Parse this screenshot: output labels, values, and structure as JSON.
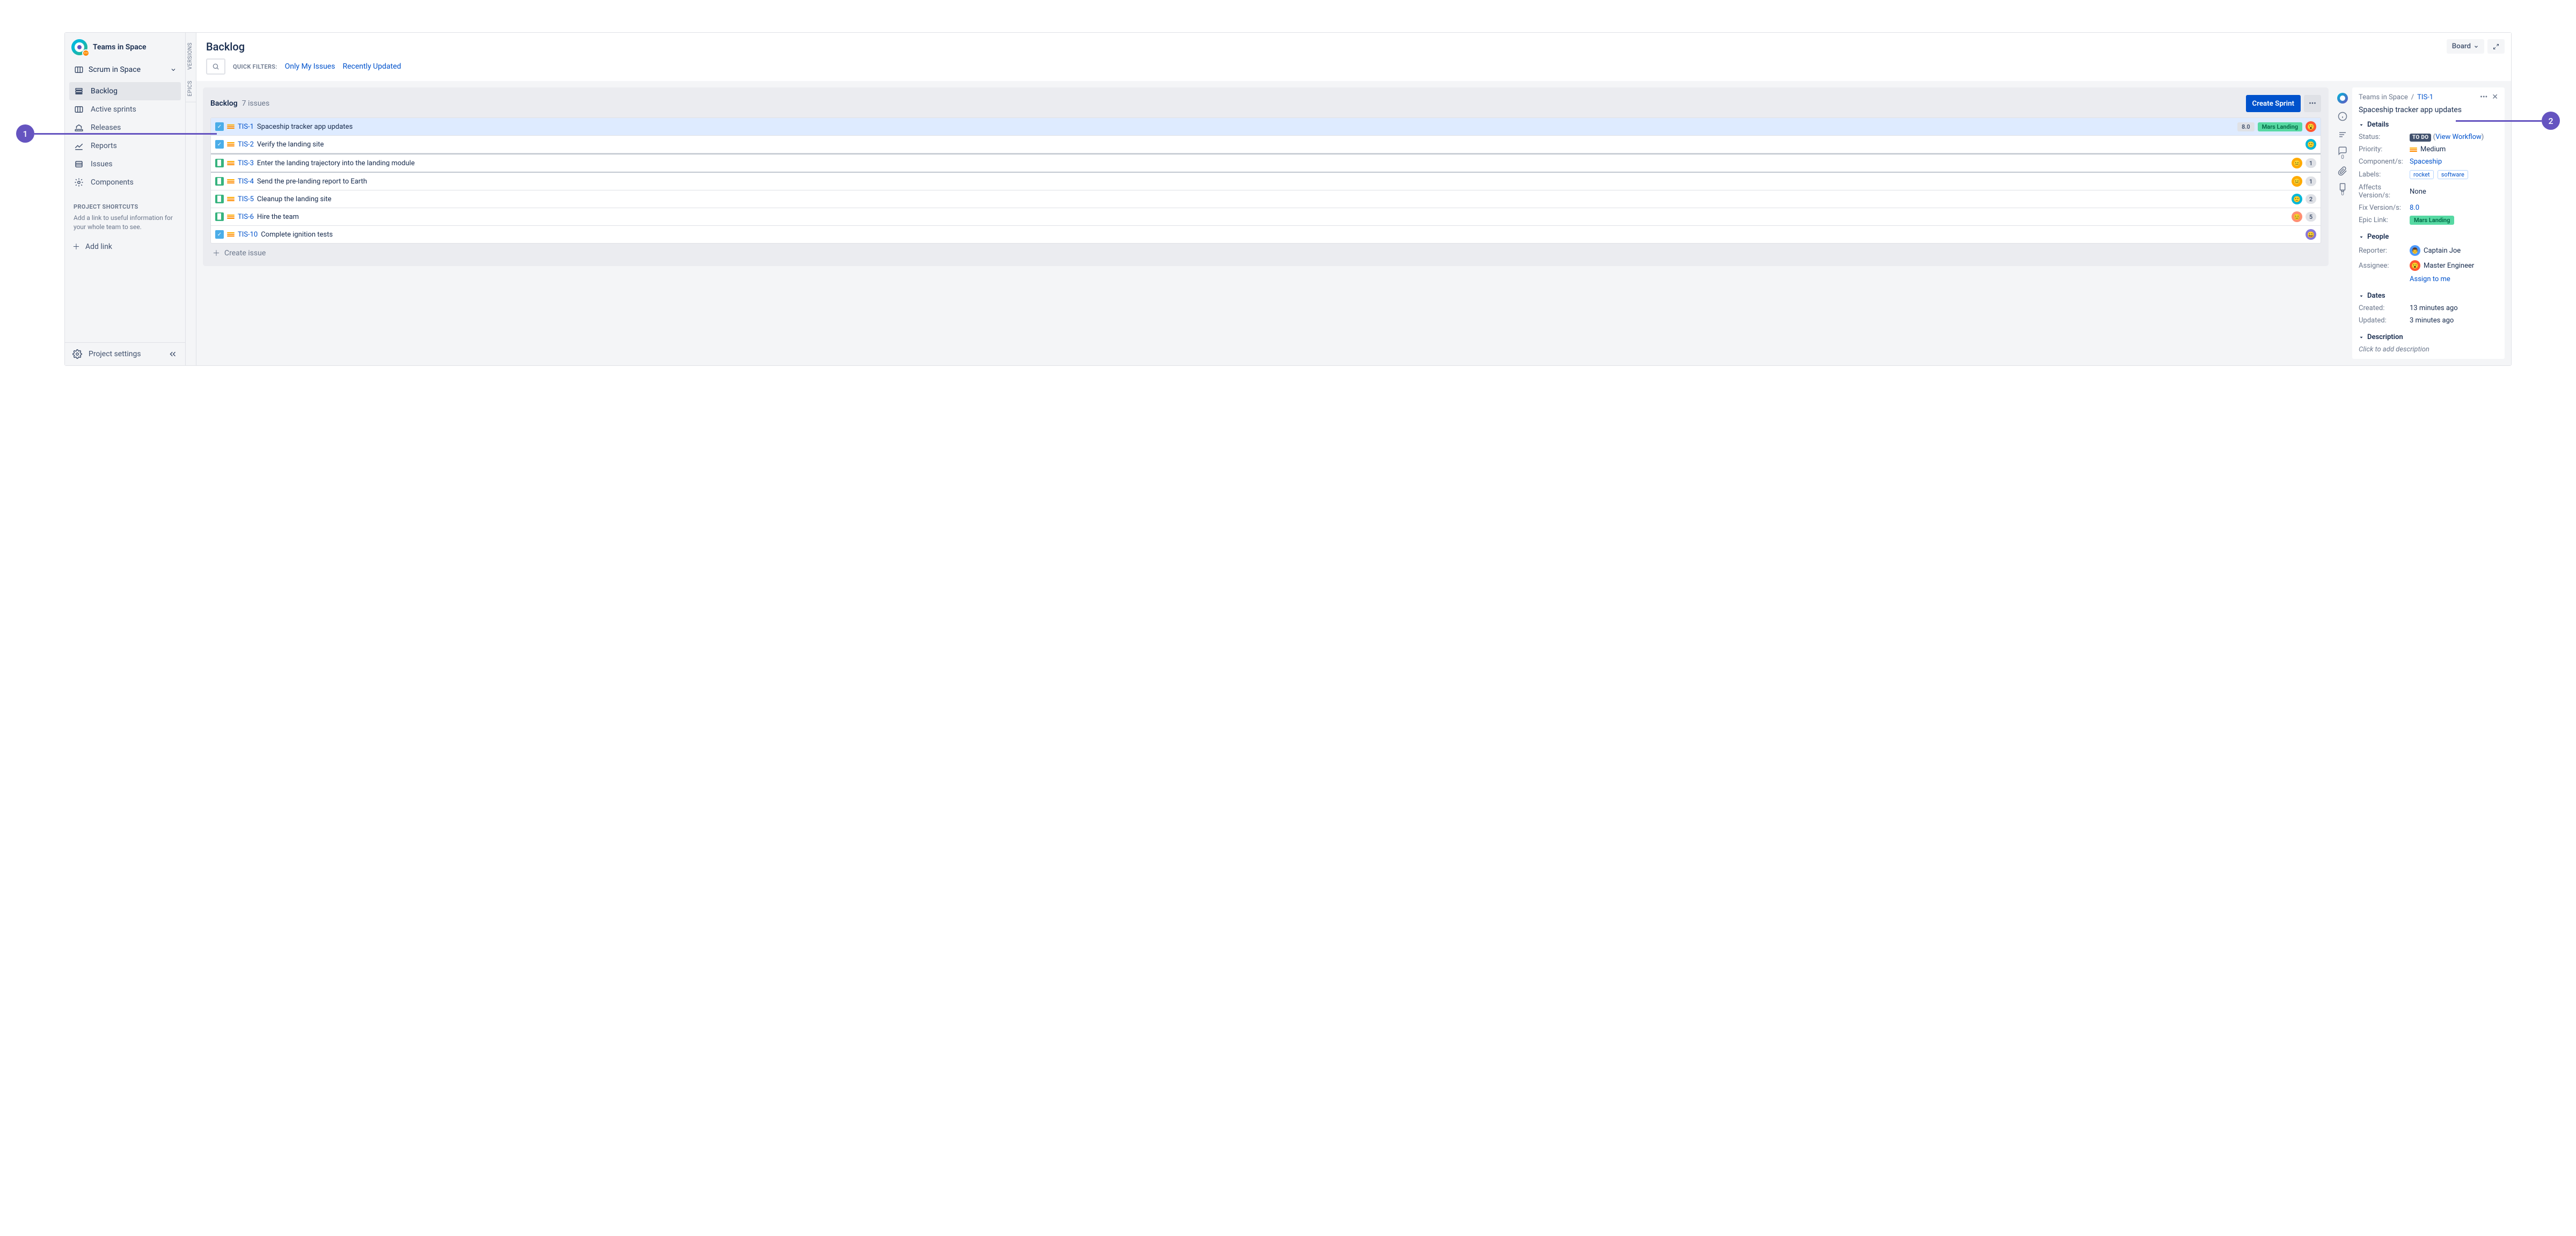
{
  "project": {
    "name": "Teams in Space",
    "board_dropdown": "Scrum in Space"
  },
  "sidebar": {
    "nav": [
      {
        "label": "Backlog",
        "icon": "backlog"
      },
      {
        "label": "Active sprints",
        "icon": "board"
      },
      {
        "label": "Releases",
        "icon": "ship"
      },
      {
        "label": "Reports",
        "icon": "chart"
      },
      {
        "label": "Issues",
        "icon": "list"
      },
      {
        "label": "Components",
        "icon": "component"
      }
    ],
    "shortcuts_title": "PROJECT SHORTCUTS",
    "shortcuts_desc": "Add a link to useful information for your whole team to see.",
    "add_link": "Add link",
    "settings": "Project settings"
  },
  "rails": {
    "versions": "VERSIONS",
    "epics": "EPICS"
  },
  "page": {
    "title": "Backlog",
    "board_button": "Board",
    "quick_filters_label": "QUICK FILTERS:",
    "filters": [
      "Only My Issues",
      "Recently Updated"
    ]
  },
  "backlog": {
    "title": "Backlog",
    "count": "7 issues",
    "create_sprint": "Create Sprint",
    "create_issue": "Create issue",
    "issues": [
      {
        "type": "task",
        "prio": "medium",
        "key": "TIS-1",
        "summary": "Spaceship tracker app updates",
        "version": "8.0",
        "epic": "Mars Landing",
        "avatar": {
          "bg": "#FF5630",
          "face": "😮"
        }
      },
      {
        "type": "task",
        "prio": "medium",
        "key": "TIS-2",
        "summary": "Verify the landing site",
        "avatar": {
          "bg": "#00B8D9",
          "face": "🙂"
        }
      },
      {
        "type": "story",
        "prio": "medium",
        "key": "TIS-3",
        "summary": "Enter the landing trajectory into the landing module",
        "avatar": {
          "bg": "#FFAB00",
          "face": "😐"
        },
        "count": "1",
        "band": true
      },
      {
        "type": "story",
        "prio": "medium",
        "key": "TIS-4",
        "summary": "Send the pre-landing report to Earth",
        "avatar": {
          "bg": "#FFAB00",
          "face": "😐"
        },
        "count": "1"
      },
      {
        "type": "story",
        "prio": "medium",
        "key": "TIS-5",
        "summary": "Cleanup the landing site",
        "avatar": {
          "bg": "#00B8D9",
          "face": "🙂"
        },
        "count": "2"
      },
      {
        "type": "story",
        "prio": "medium",
        "key": "TIS-6",
        "summary": "Hire the team",
        "avatar": {
          "bg": "#FF8F73",
          "face": "😊"
        },
        "count": "5"
      },
      {
        "type": "task",
        "prio": "medium",
        "key": "TIS-10",
        "summary": "Complete ignition tests",
        "avatar": {
          "bg": "#8777D9",
          "face": "😀"
        }
      }
    ]
  },
  "detail": {
    "breadcrumb_project": "Teams in Space",
    "breadcrumb_sep": "/",
    "breadcrumb_key": "TIS-1",
    "title": "Spaceship tracker app updates",
    "tabs_counts": {
      "comments": "0",
      "pages": "0"
    },
    "sections": {
      "details": "Details",
      "people": "People",
      "dates": "Dates",
      "description": "Description"
    },
    "fields": {
      "status_label": "Status:",
      "status_value": "TO DO",
      "status_workflow": "View Workflow",
      "priority_label": "Priority:",
      "priority_value": "Medium",
      "components_label": "Component/s:",
      "components_value": "Spaceship",
      "labels_label": "Labels:",
      "labels_values": [
        "rocket",
        "software"
      ],
      "affects_label": "Affects Version/s:",
      "affects_value": "None",
      "fix_label": "Fix Version/s:",
      "fix_value": "8.0",
      "epic_label": "Epic Link:",
      "epic_value": "Mars Landing",
      "reporter_label": "Reporter:",
      "reporter_value": "Captain Joe",
      "assignee_label": "Assignee:",
      "assignee_value": "Master Engineer",
      "assign_to_me": "Assign to me",
      "created_label": "Created:",
      "created_value": "13 minutes ago",
      "updated_label": "Updated:",
      "updated_value": "3 minutes ago",
      "description_placeholder": "Click to add description"
    }
  },
  "callouts": {
    "one": "1",
    "two": "2"
  }
}
